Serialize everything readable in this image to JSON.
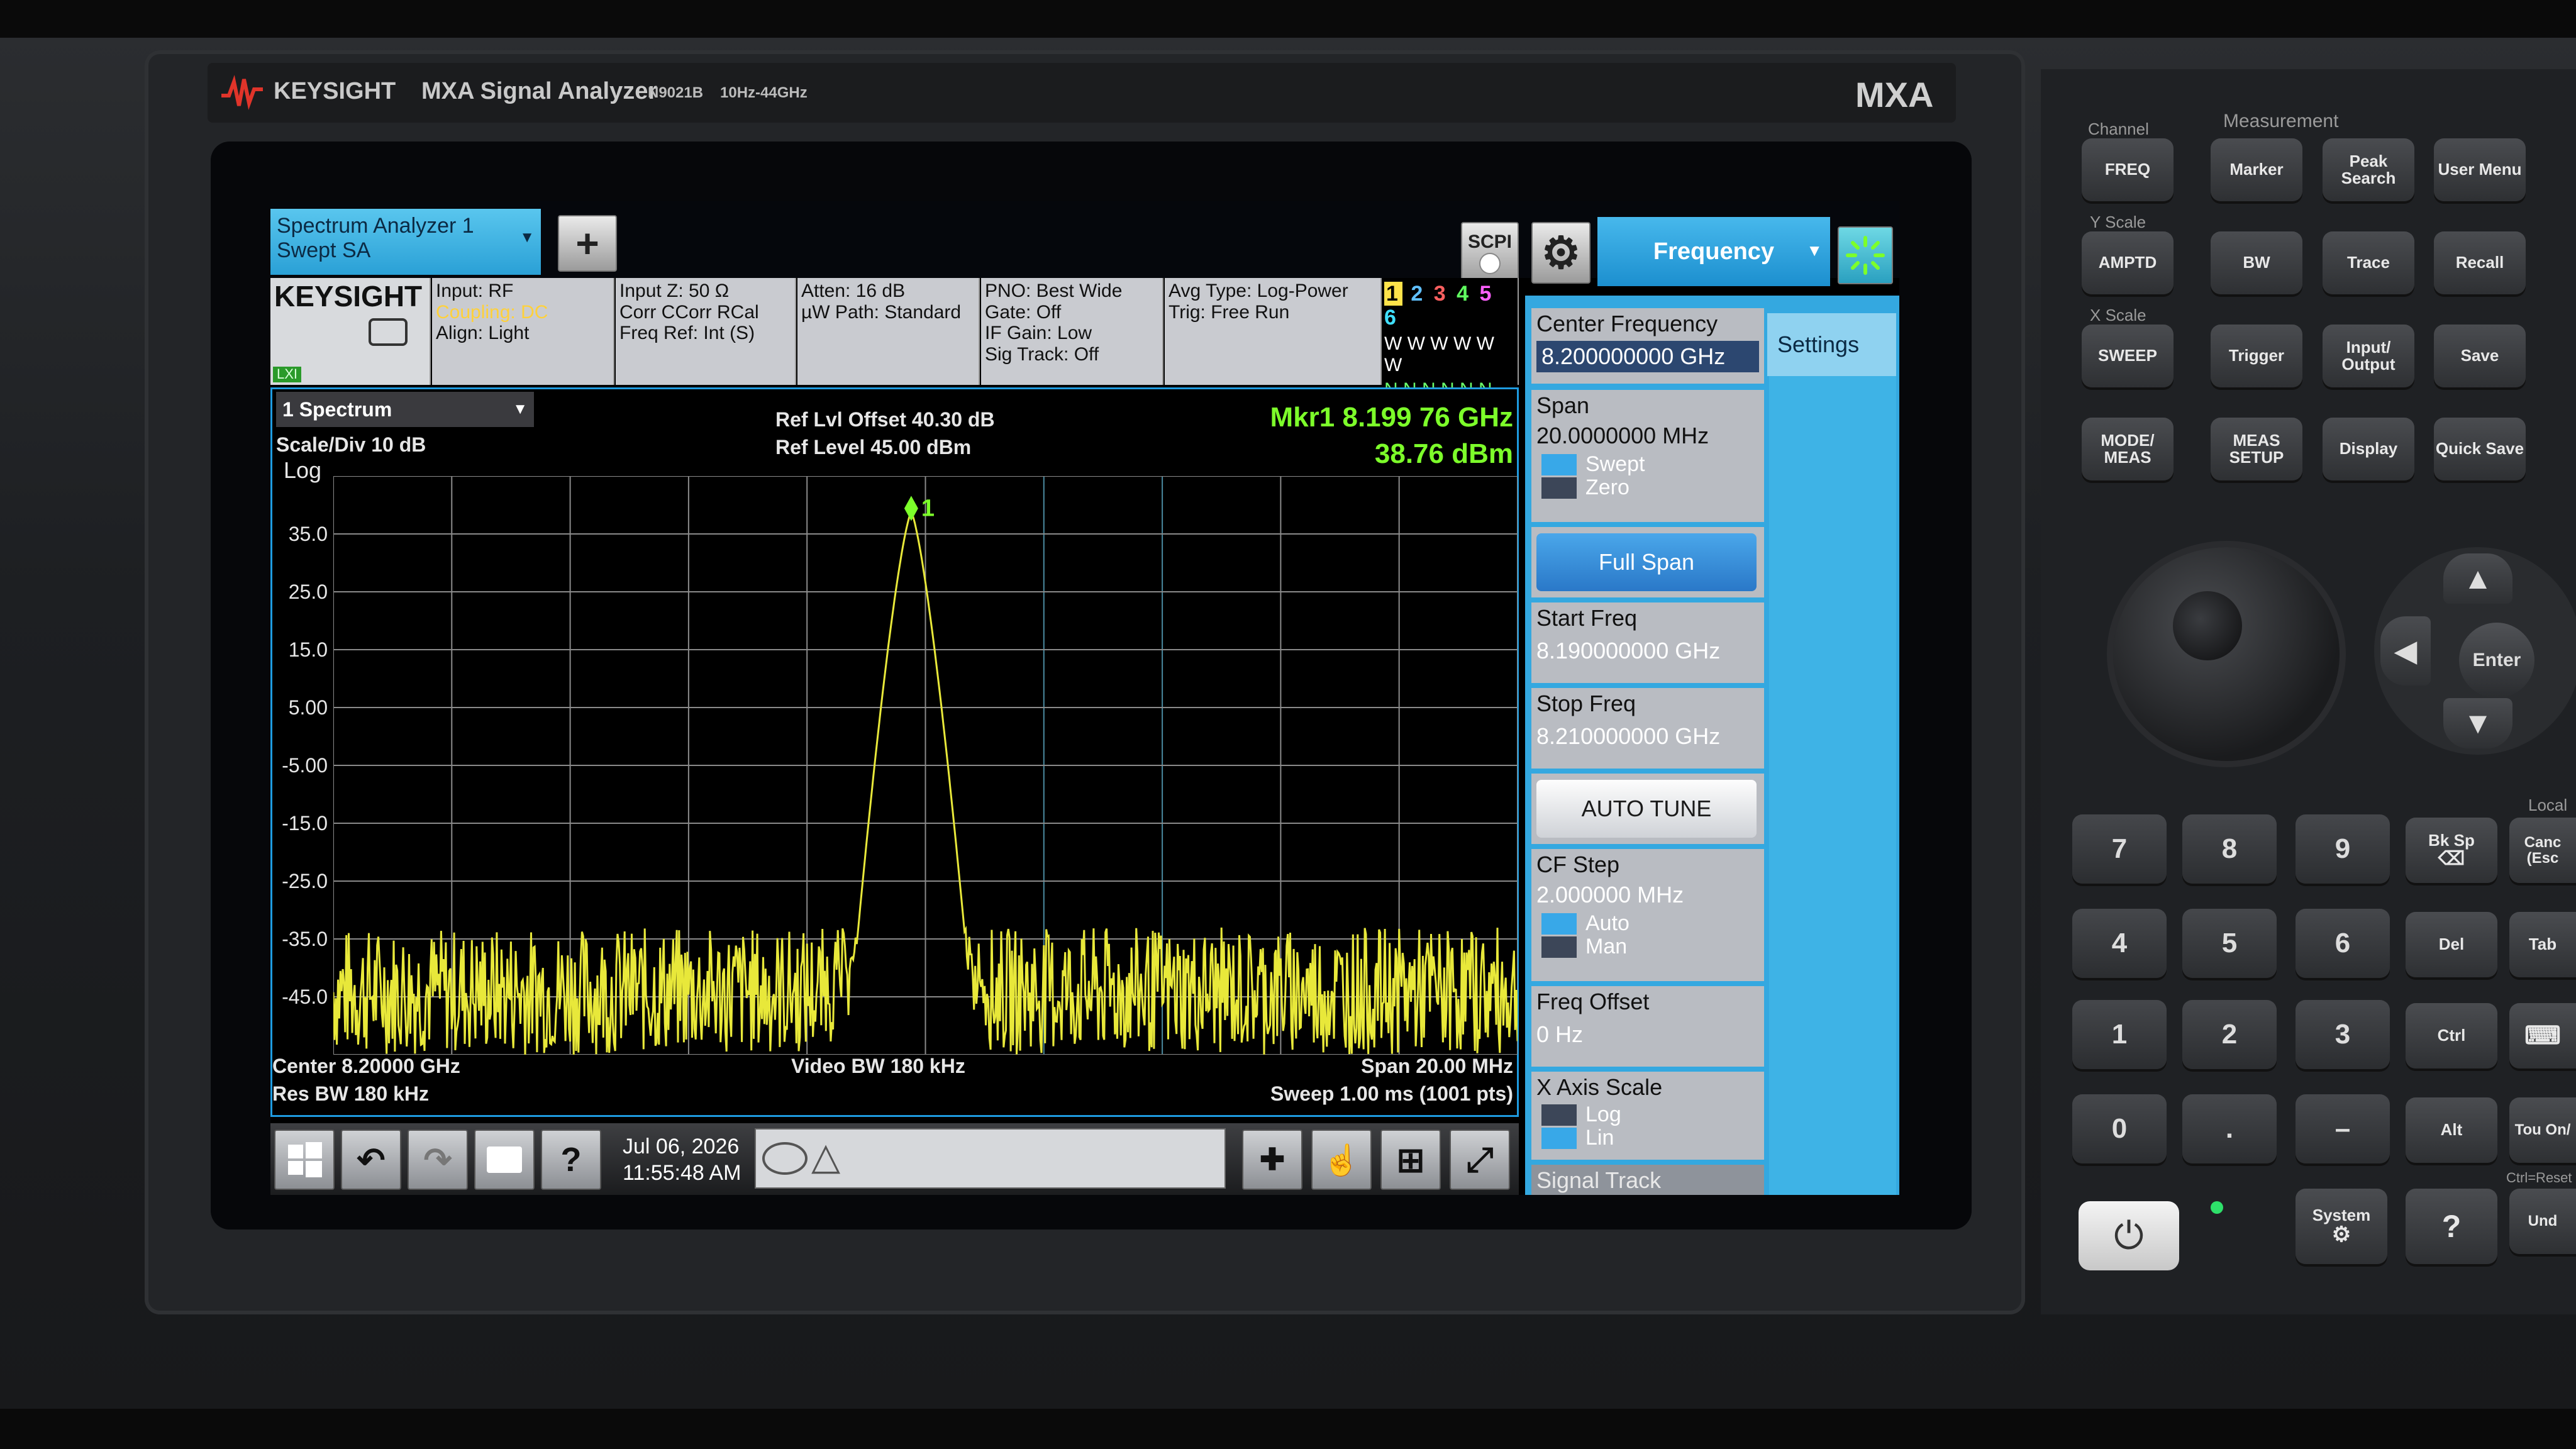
{
  "instrument": {
    "brand": "KEYSIGHT",
    "model_name": "MXA Signal Analyzer",
    "model_number": "N9021B",
    "freq_range": "10Hz-44GHz",
    "badge": "MXA"
  },
  "front_panel": {
    "groups": {
      "channel": "Channel",
      "measurement": "Measurement",
      "y_scale": "Y Scale",
      "x_scale": "X Scale",
      "local": "Local",
      "ctrl_reset": "Ctrl=Reset"
    },
    "keys": {
      "freq": "FREQ",
      "marker": "Marker",
      "peak_search": "Peak Search",
      "user_menu": "User Menu",
      "ampt": "AMPTD",
      "bw": "BW",
      "trace": "Trace",
      "recall": "Recall",
      "sweep": "SWEEP",
      "trigger": "Trigger",
      "input_output": "Input/ Output",
      "save": "Save",
      "mode_meas": "MODE/ MEAS",
      "meas_setup": "MEAS SETUP",
      "display": "Display",
      "quick_save": "Quick Save",
      "enter": "Enter",
      "bk_sp": "Bk Sp",
      "cancel": "Canc (Esc",
      "del": "Del",
      "tab": "Tab",
      "ctrl": "Ctrl",
      "alt": "Alt",
      "touch": "Tou On/",
      "undo": "Und",
      "system": "System"
    },
    "numpad": [
      "7",
      "8",
      "9",
      "4",
      "5",
      "6",
      "1",
      "2",
      "3",
      "0",
      ".",
      "–"
    ]
  },
  "screen": {
    "window_tab": {
      "line1": "Spectrum Analyzer 1",
      "line2": "Swept SA"
    },
    "scpi": "SCPI",
    "menu_title": "Frequency",
    "settings_tab": "Settings",
    "info": {
      "logo": "KEYSIGHT",
      "lxi": "LXI",
      "col1": [
        "Input: RF",
        "Coupling: DC",
        "Align: Light"
      ],
      "col2": [
        "Input Z: 50 Ω",
        "Corr CCorr RCal",
        "Freq Ref: Int (S)"
      ],
      "col3": [
        "Atten: 16 dB",
        "µW Path: Standard"
      ],
      "col4": [
        "PNO: Best Wide",
        "Gate: Off",
        "IF Gain: Low",
        "Sig Track: Off"
      ],
      "col5": [
        "Avg Type: Log-Power",
        "Trig: Free Run"
      ],
      "trace_nums": [
        "1",
        "2",
        "3",
        "4",
        "5",
        "6"
      ],
      "trace_types": "W W W W W W",
      "trace_det": "N N N N N N"
    },
    "plot": {
      "trace_selector": "1 Spectrum",
      "scale_div": "Scale/Div 10 dB",
      "log": "Log",
      "ref_offset": "Ref Lvl Offset 40.30 dB",
      "ref_level": "Ref Level 45.00 dBm",
      "mkr_freq": "Mkr1 8.199 76 GHz",
      "mkr_amp": "38.76 dBm",
      "marker_label": "1",
      "center": "Center 8.20000 GHz",
      "res_bw": "Res BW 180 kHz",
      "video_bw": "Video BW 180 kHz",
      "span": "Span 20.00 MHz",
      "sweep": "Sweep 1.00 ms (1001 pts)"
    },
    "softkeys": {
      "center_freq": {
        "label": "Center Frequency",
        "value": "8.200000000 GHz"
      },
      "span": {
        "label": "Span",
        "value": "20.0000000 MHz",
        "opt1": "Swept",
        "opt2": "Zero"
      },
      "full_span": "Full Span",
      "start_freq": {
        "label": "Start Freq",
        "value": "8.190000000 GHz"
      },
      "stop_freq": {
        "label": "Stop Freq",
        "value": "8.210000000 GHz"
      },
      "auto_tune": "AUTO TUNE",
      "cf_step": {
        "label": "CF Step",
        "value": "2.000000 MHz",
        "opt1": "Auto",
        "opt2": "Man"
      },
      "freq_offset": {
        "label": "Freq Offset",
        "value": "0 Hz"
      },
      "x_axis": {
        "label": "X Axis Scale",
        "opt1": "Log",
        "opt2": "Lin"
      },
      "signal_track": "Signal Track"
    },
    "taskbar": {
      "date": "Jul 06, 2026",
      "time": "11:55:48 AM"
    }
  },
  "chart_data": {
    "type": "line",
    "x_label": "",
    "y_label": "",
    "y_ticks": [
      "35.0",
      "25.0",
      "15.0",
      "5.00",
      "-5.00",
      "-15.0",
      "-25.0",
      "-35.0",
      "-45.0"
    ],
    "ylim": [
      -55.0,
      45.0
    ],
    "xlim_ghz": [
      8.19,
      8.21
    ],
    "grid": true,
    "trace_color": "#e8e83a",
    "peak": {
      "x_ghz": 8.19976,
      "y_dbm": 38.76
    },
    "noise_floor_dbm": -40.0
  },
  "colors": {
    "accent": "#2aa0d6",
    "marker_green": "#7dff2a",
    "trace": "#e8e83a",
    "coupling": "#ffd13a"
  }
}
